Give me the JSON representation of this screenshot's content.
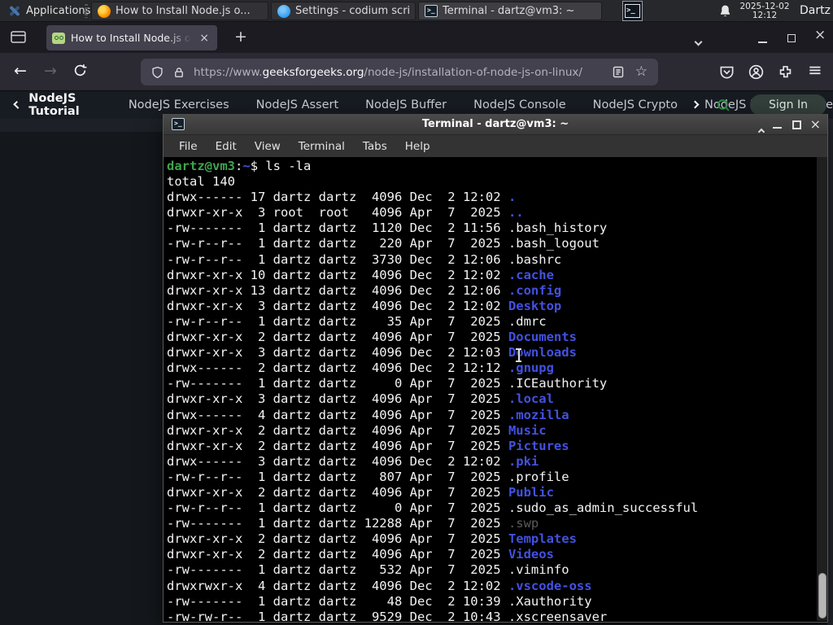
{
  "panel": {
    "applications_label": "Applications",
    "windows": [
      {
        "label": "How to Install Node.js o..."
      },
      {
        "label": "Settings - codium script..."
      },
      {
        "label": "Terminal - dartz@vm3: ~"
      }
    ],
    "clock": {
      "date": "2025-12-02",
      "time": "12:12"
    },
    "user": "Dartz"
  },
  "browser": {
    "tab_title": "How to Install Node.js on",
    "url": {
      "scheme": "https://www.",
      "domain": "geeksforgeeks.org",
      "path": "/node-js/installation-of-node-js-on-linux/"
    }
  },
  "site_nav": {
    "current": "NodeJS Tutorial",
    "items": [
      "NodeJS Exercises",
      "NodeJS Assert",
      "NodeJS Buffer",
      "NodeJS Console",
      "NodeJS Crypto",
      "NodeJS DNS",
      "Node"
    ],
    "sign_in_label": "Sign In"
  },
  "terminal_window": {
    "title": "Terminal - dartz@vm3: ~",
    "menu": [
      "File",
      "Edit",
      "View",
      "Terminal",
      "Tabs",
      "Help"
    ]
  },
  "terminal": {
    "colors": {
      "prompt_green": "#3fa44e",
      "dir_blue": "#4351e0",
      "dim_gray": "#5a5a5a",
      "foreground": "#f3f3f3",
      "background": "#000000"
    },
    "lines": [
      [
        [
          "dartz@vm3",
          "g"
        ],
        [
          ":",
          "f"
        ],
        [
          "~",
          "b"
        ],
        [
          "$ ls -la",
          "f"
        ]
      ],
      [
        [
          "total 140",
          "f"
        ]
      ],
      [
        [
          "drwx------ 17 dartz dartz  4096 Dec  2 12:02 ",
          "f"
        ],
        [
          ".",
          "b"
        ]
      ],
      [
        [
          "drwxr-xr-x  3 root  root   4096 Apr  7  2025 ",
          "f"
        ],
        [
          "..",
          "b"
        ]
      ],
      [
        [
          "-rw-------  1 dartz dartz  1120 Dec  2 11:56 .bash_history",
          "f"
        ]
      ],
      [
        [
          "-rw-r--r--  1 dartz dartz   220 Apr  7  2025 .bash_logout",
          "f"
        ]
      ],
      [
        [
          "-rw-r--r--  1 dartz dartz  3730 Dec  2 12:06 .bashrc",
          "f"
        ]
      ],
      [
        [
          "drwxr-xr-x 10 dartz dartz  4096 Dec  2 12:02 ",
          "f"
        ],
        [
          ".cache",
          "b"
        ]
      ],
      [
        [
          "drwxr-xr-x 13 dartz dartz  4096 Dec  2 12:06 ",
          "f"
        ],
        [
          ".config",
          "b"
        ]
      ],
      [
        [
          "drwxr-xr-x  3 dartz dartz  4096 Dec  2 12:02 ",
          "f"
        ],
        [
          "Desktop",
          "b"
        ]
      ],
      [
        [
          "-rw-r--r--  1 dartz dartz    35 Apr  7  2025 .dmrc",
          "f"
        ]
      ],
      [
        [
          "drwxr-xr-x  2 dartz dartz  4096 Apr  7  2025 ",
          "f"
        ],
        [
          "Documents",
          "b"
        ]
      ],
      [
        [
          "drwxr-xr-x  3 dartz dartz  4096 Dec  2 12:03 ",
          "f"
        ],
        [
          "Downloads",
          "b"
        ]
      ],
      [
        [
          "drwx------  2 dartz dartz  4096 Dec  2 12:12 ",
          "f"
        ],
        [
          ".gnupg",
          "b"
        ]
      ],
      [
        [
          "-rw-------  1 dartz dartz     0 Apr  7  2025 .ICEauthority",
          "f"
        ]
      ],
      [
        [
          "drwxr-xr-x  3 dartz dartz  4096 Apr  7  2025 ",
          "f"
        ],
        [
          ".local",
          "b"
        ]
      ],
      [
        [
          "drwx------  4 dartz dartz  4096 Apr  7  2025 ",
          "f"
        ],
        [
          ".mozilla",
          "b"
        ]
      ],
      [
        [
          "drwxr-xr-x  2 dartz dartz  4096 Apr  7  2025 ",
          "f"
        ],
        [
          "Music",
          "b"
        ]
      ],
      [
        [
          "drwxr-xr-x  2 dartz dartz  4096 Apr  7  2025 ",
          "f"
        ],
        [
          "Pictures",
          "b"
        ]
      ],
      [
        [
          "drwx------  3 dartz dartz  4096 Dec  2 12:02 ",
          "f"
        ],
        [
          ".pki",
          "b"
        ]
      ],
      [
        [
          "-rw-r--r--  1 dartz dartz   807 Apr  7  2025 .profile",
          "f"
        ]
      ],
      [
        [
          "drwxr-xr-x  2 dartz dartz  4096 Apr  7  2025 ",
          "f"
        ],
        [
          "Public",
          "b"
        ]
      ],
      [
        [
          "-rw-r--r--  1 dartz dartz     0 Apr  7  2025 .sudo_as_admin_successful",
          "f"
        ]
      ],
      [
        [
          "-rw-------  1 dartz dartz 12288 Apr  7  2025 ",
          "f"
        ],
        [
          ".swp",
          "d"
        ]
      ],
      [
        [
          "drwxr-xr-x  2 dartz dartz  4096 Apr  7  2025 ",
          "f"
        ],
        [
          "Templates",
          "b"
        ]
      ],
      [
        [
          "drwxr-xr-x  2 dartz dartz  4096 Apr  7  2025 ",
          "f"
        ],
        [
          "Videos",
          "b"
        ]
      ],
      [
        [
          "-rw-------  1 dartz dartz   532 Apr  7  2025 .viminfo",
          "f"
        ]
      ],
      [
        [
          "drwxrwxr-x  4 dartz dartz  4096 Dec  2 12:02 ",
          "f"
        ],
        [
          ".vscode-oss",
          "b"
        ]
      ],
      [
        [
          "-rw-------  1 dartz dartz    48 Dec  2 10:39 .Xauthority",
          "f"
        ]
      ],
      [
        [
          "-rw-rw-r--  1 dartz dartz  9529 Dec  2 10:43 .xscreensaver",
          "f"
        ]
      ]
    ]
  },
  "icons": {
    "plus": "+",
    "close": "×",
    "back": "←",
    "forward": "→",
    "hamburger": "≡",
    "star": "☆",
    "prompt_glyph": ">_"
  }
}
